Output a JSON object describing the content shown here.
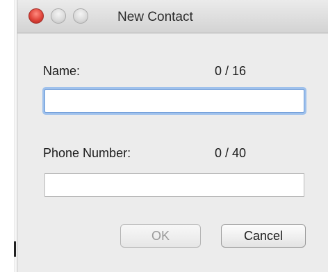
{
  "window": {
    "title": "New Contact"
  },
  "form": {
    "name": {
      "label": "Name:",
      "counter": "0 / 16",
      "value": ""
    },
    "phone": {
      "label": "Phone Number:",
      "counter": "0 / 40",
      "value": ""
    }
  },
  "buttons": {
    "ok_label": "OK",
    "cancel_label": "Cancel"
  }
}
